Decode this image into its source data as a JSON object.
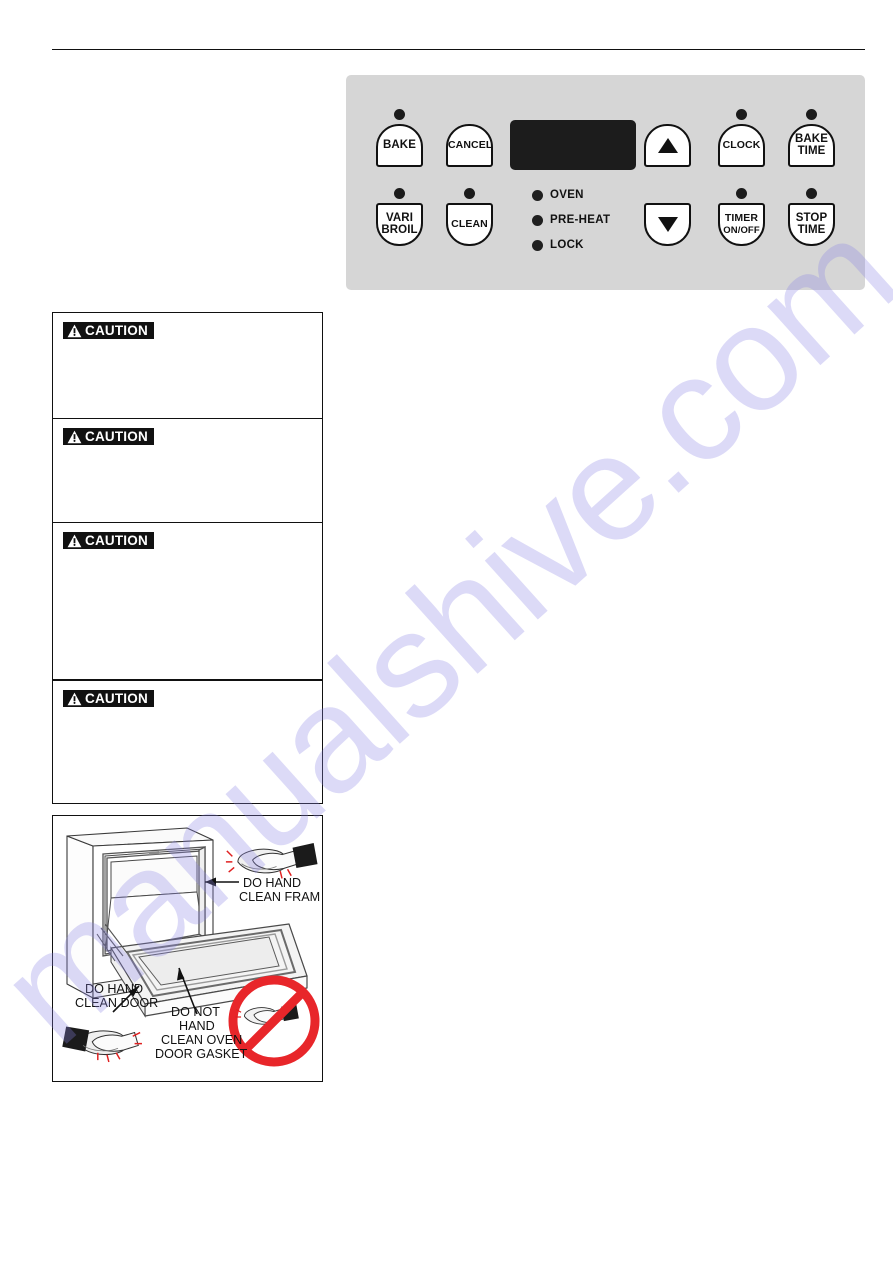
{
  "page": {
    "background_color": "#ffffff",
    "watermark_text": "manualshive.com",
    "watermark_color": "#8a86e6"
  },
  "control_panel": {
    "background_color": "#d6d6d6",
    "display_color": "#1c1c1c",
    "display_value": "",
    "buttons": [
      {
        "name": "bake",
        "line1": "BAKE",
        "line2": "",
        "shape": "dome",
        "has_led": true
      },
      {
        "name": "cancel",
        "line1": "CANCEL",
        "line2": "",
        "shape": "dome",
        "has_led": false
      },
      {
        "name": "arrow-up",
        "line1": "",
        "line2": "",
        "shape": "dome",
        "has_led": false,
        "icon": "triangle-up-icon"
      },
      {
        "name": "clock",
        "line1": "CLOCK",
        "line2": "",
        "shape": "dome",
        "has_led": true
      },
      {
        "name": "bake-time",
        "line1": "BAKE",
        "line2": "TIME",
        "shape": "dome",
        "has_led": true
      },
      {
        "name": "vari-broil",
        "line1": "VARI",
        "line2": "BROIL",
        "shape": "dome-down",
        "has_led": true
      },
      {
        "name": "clean",
        "line1": "CLEAN",
        "line2": "",
        "shape": "dome-down",
        "has_led": true
      },
      {
        "name": "arrow-down",
        "line1": "",
        "line2": "",
        "shape": "dome-down",
        "has_led": false,
        "icon": "triangle-down-icon"
      },
      {
        "name": "timer-onoff",
        "line1": "TIMER",
        "line2": "ON/OFF",
        "shape": "dome-down",
        "has_led": true
      },
      {
        "name": "stop-time",
        "line1": "STOP",
        "line2": "TIME",
        "shape": "dome-down",
        "has_led": true
      }
    ],
    "indicators": [
      {
        "name": "oven",
        "label": "OVEN"
      },
      {
        "name": "pre-heat",
        "label": "PRE-HEAT"
      },
      {
        "name": "lock",
        "label": "LOCK"
      }
    ]
  },
  "caution_boxes": [
    {
      "label": "CAUTION",
      "body": ""
    },
    {
      "label": "CAUTION",
      "body": ""
    },
    {
      "label": "CAUTION",
      "body": ""
    },
    {
      "label": "CAUTION",
      "body": ""
    }
  ],
  "illustration": {
    "callouts": [
      {
        "name": "do-hand-clean-frame",
        "line1": "DO HAND",
        "line2": "CLEAN FRAME",
        "line3": "",
        "line4": ""
      },
      {
        "name": "do-hand-clean-door",
        "line1": "DO HAND",
        "line2": "CLEAN DOOR",
        "line3": "",
        "line4": ""
      },
      {
        "name": "do-not-hand-clean-oven-door-gasket",
        "line1": "DO  NOT",
        "line2": "HAND",
        "line3": "CLEAN OVEN",
        "line4": "DOOR GASKET"
      }
    ],
    "prohibition_color": "#e8262a"
  }
}
